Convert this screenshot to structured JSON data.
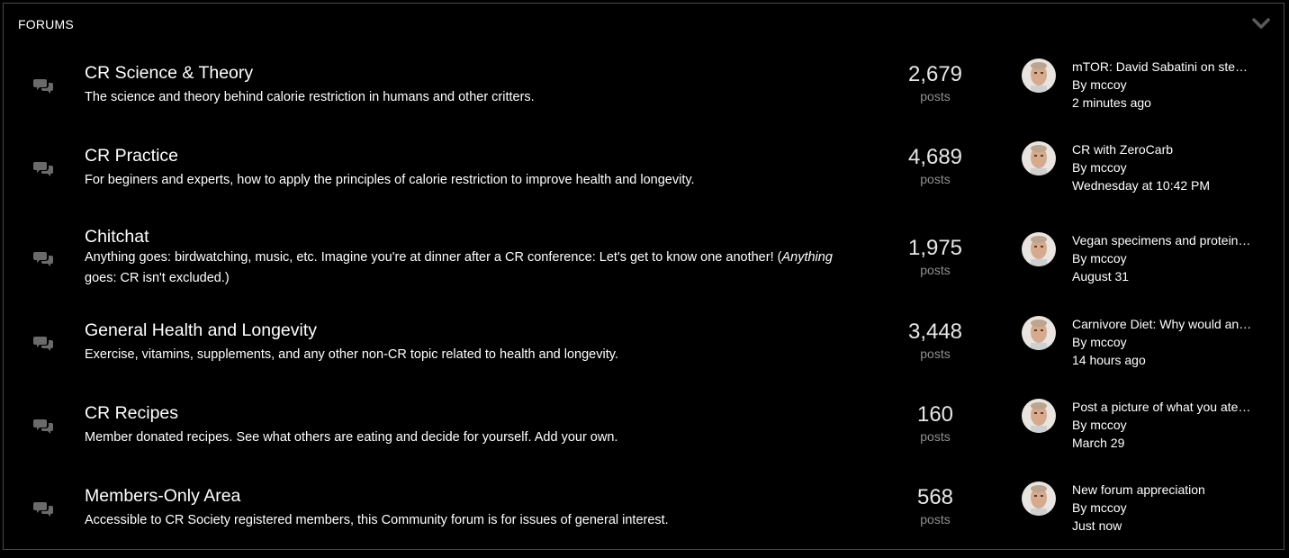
{
  "header": {
    "title": "FORUMS",
    "toggle_icon": "chevron-down-icon"
  },
  "forums": [
    {
      "title": "CR Science & Theory",
      "description": "The science and theory behind calorie restriction in humans and other critters.",
      "description_rest": "",
      "count": "2,679",
      "count_label": "posts",
      "last_title": "mTOR: David Sabatini on stem cells and fasting",
      "by": "By",
      "author": "mccoy",
      "time": "2 minutes ago"
    },
    {
      "title": "CR Practice",
      "description": "For beginers and experts, how to apply the principles of calorie restriction to improve health and longevity.",
      "description_rest": "",
      "count": "4,689",
      "count_label": "posts",
      "last_title": "CR with ZeroCarb",
      "by": "By",
      "author": "mccoy",
      "time": "Wednesday at 10:42 PM"
    },
    {
      "title": "Chitchat",
      "description": "Anything goes: birdwatching, music, etc. Imagine you're at dinner after a CR conference: Let's get to know one another! (",
      "description_em": "Anything",
      "description_rest": " goes: CR isn't excluded.)",
      "count": "1,975",
      "count_label": "posts",
      "last_title": "Vegan specimens and protein intake",
      "by": "By",
      "author": "mccoy",
      "time": "August 31"
    },
    {
      "title": "General Health and Longevity",
      "description": "Exercise, vitamins, supplements, and any other non-CR topic related to health and longevity.",
      "description_rest": "",
      "count": "3,448",
      "count_label": "posts",
      "last_title": "Carnivore Diet: Why would anyone do this",
      "by": "By",
      "author": "mccoy",
      "time": "14 hours ago"
    },
    {
      "title": "CR Recipes",
      "description": "Member donated recipes. See what others are eating and decide for yourself. Add your own.",
      "description_rest": "",
      "count": "160",
      "count_label": "posts",
      "last_title": "Post a picture of what you ate today",
      "by": "By",
      "author": "mccoy",
      "time": "March 29"
    },
    {
      "title": "Members-Only Area",
      "description": "Accessible to CR Society registered members, this Community forum is for issues of general interest.",
      "description_rest": "",
      "count": "568",
      "count_label": "posts",
      "last_title": "New forum appreciation",
      "by": "By",
      "author": "mccoy",
      "time": "Just now"
    }
  ],
  "colors": {
    "background": "#000000",
    "border": "#4a4a4a",
    "text": "#ffffff",
    "muted": "#8f8f8f",
    "icon": "#6a6a6a"
  }
}
